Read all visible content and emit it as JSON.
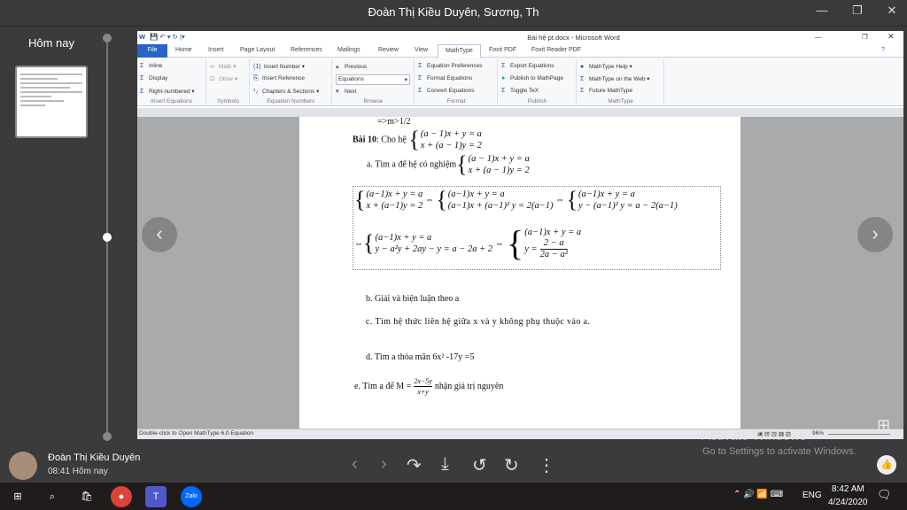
{
  "viewer": {
    "title": "Đoàn Thị Kiều Duyên, Sương, Th",
    "section": "Hôm nay",
    "sender": "Đoàn Thị Kiều Duyên",
    "time": "08:41 Hôm nay"
  },
  "word": {
    "title": "Bài hệ pt.docx - Microsoft Word",
    "tabs": [
      "File",
      "Home",
      "Insert",
      "Page Layout",
      "References",
      "Mailings",
      "Review",
      "View",
      "MathType",
      "Foxit PDF",
      "Foxit Reader PDF"
    ],
    "groups": [
      {
        "label": "Insert Equations",
        "items": [
          "Inline",
          "Display",
          "Right-numbered ▾"
        ]
      },
      {
        "label": "Symbols",
        "items": [
          "Math ▾",
          "Other ▾"
        ]
      },
      {
        "label": "Equation Numbers",
        "items": [
          "Insert Number ▾",
          "Insert Reference",
          "Chapters & Sections ▾"
        ]
      },
      {
        "label": "Browse",
        "items": [
          "Previous",
          "Equations",
          "Next"
        ]
      },
      {
        "label": "Format",
        "items": [
          "Equation Preferences",
          "Format Equations",
          "Convert Equations"
        ]
      },
      {
        "label": "Publish",
        "items": [
          "Export Equations",
          "Publish to MathPage",
          "Toggle TeX"
        ]
      },
      {
        "label": "MathType",
        "items": [
          "MathType Help ▾",
          "MathType on the Web ▾",
          "Future MathType"
        ]
      }
    ],
    "status": "Double-click to Open MathType 6.0 Equation",
    "zoom": "96%"
  },
  "doc": {
    "prev": "=>m>1/2",
    "bai10_label": "Bài 10",
    "bai10_text": ": Cho hệ",
    "sys1": [
      "(a − 1)x + y = a",
      "x + (a − 1)y = 2"
    ],
    "a": "a.  Tìm a để hệ có nghiệm",
    "eq": {
      "s1": [
        "(a−1)x + y = a",
        "x + (a−1)y = 2"
      ],
      "s2": [
        "(a−1)x + y = a",
        "(a−1)x + (a−1)² y = 2(a−1)"
      ],
      "s3": [
        "(a−1)x + y = a",
        "y − (a−1)² y = a − 2(a−1)"
      ],
      "s4": [
        "(a−1)x + y = a",
        "y − a²y + 2ay − y = a − 2a + 2"
      ],
      "s5a": "(a−1)x + y = a",
      "s5y": "y =",
      "s5num": "2 − a",
      "s5den": "2a − a²",
      "iff": "⇔"
    },
    "b": "b.  Giải và biện luận theo a",
    "c": "c.  Tìm hệ thức liên hệ giữa x và y không phụ thuộc vào a.",
    "d": "d.  Tìm a thỏa mãn 6x² -17y =5",
    "e_pre": "e. Tìm a để M =",
    "e_num": "2x−5y",
    "e_den": "x+y",
    "e_post": "nhận giá trị nguyên"
  },
  "watermark": {
    "line1": "Activate Windows",
    "line2": "Go to Settings to activate Windows."
  },
  "taskbar": {
    "lang": "ENG",
    "time": "8:42 AM",
    "date": "4/24/2020"
  }
}
